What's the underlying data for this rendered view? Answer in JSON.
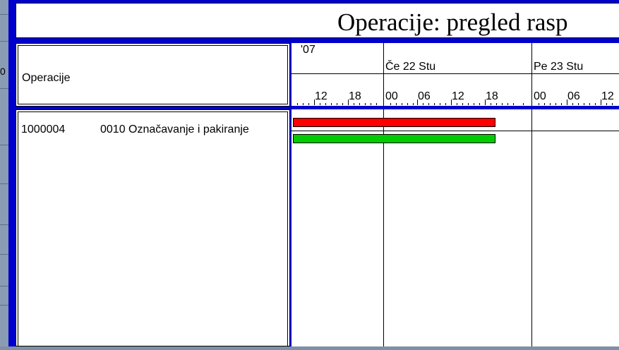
{
  "window": {
    "title": "Operacije: pregled rasp"
  },
  "left_fragment": "0",
  "header": {
    "operations_label": "Operacije"
  },
  "timeline": {
    "year_label": "'07",
    "days": [
      {
        "label": "Če 22 Stu"
      },
      {
        "label": "Pe 23 Stu"
      }
    ],
    "hour_ticks": [
      "12",
      "18",
      "00",
      "06",
      "12",
      "18",
      "00",
      "06",
      "12"
    ]
  },
  "operations": [
    {
      "order": "1000004",
      "description": "0010 Označavanje i pakiranje",
      "bars": [
        {
          "kind": "planned",
          "color": "#ff0000"
        },
        {
          "kind": "actual",
          "color": "#00cc00"
        }
      ]
    }
  ],
  "colors": {
    "frame": "#0000cc",
    "planned_bar": "#ff0000",
    "actual_bar": "#00cc00"
  }
}
